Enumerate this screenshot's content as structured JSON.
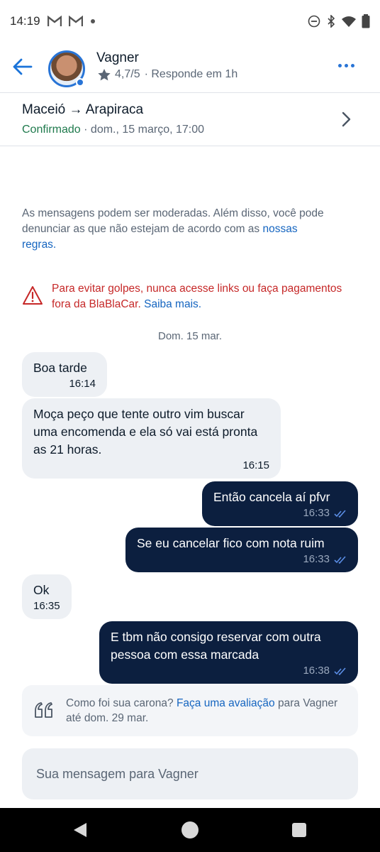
{
  "status_bar": {
    "time": "14:19",
    "notification_icons": [
      "gmail-icon",
      "gmail-icon",
      "dot-icon"
    ],
    "system_icons": [
      "do-not-disturb-icon",
      "bluetooth-icon",
      "wifi-icon",
      "battery-icon"
    ]
  },
  "header": {
    "driver_name": "Vagner",
    "rating": "4,7/5",
    "response_time": "· Responde em 1h"
  },
  "trip": {
    "route": "Maceió → Arapiraca",
    "status": "Confirmado",
    "datetime": "· dom., 15 março, 17:00"
  },
  "notices": {
    "moderation_text": "As mensagens podem ser moderadas. Além disso, você pode denunciar as que não estejam de acordo com as",
    "moderation_link": "nossas regras.",
    "warning_text": "Para evitar golpes, nunca acesse links ou faça pagamentos fora da BlaBlaCar.",
    "warning_link": "Saiba mais."
  },
  "conversation": {
    "date_label": "Dom. 15 mar.",
    "messages": [
      {
        "direction": "in",
        "text": "Boa tarde",
        "time": "16:14"
      },
      {
        "direction": "in",
        "text": "Moça peço que tente outro vim buscar uma encomenda e ela só vai está pronta as 21 horas.",
        "time": "16:15"
      },
      {
        "direction": "out",
        "text": "Então cancela aí pfvr",
        "time": "16:33",
        "read": true
      },
      {
        "direction": "out",
        "text": "Se eu cancelar fico com nota ruim",
        "time": "16:33",
        "read": true
      },
      {
        "direction": "in",
        "text": "Ok",
        "time": "16:35"
      },
      {
        "direction": "out",
        "text": "E tbm não consigo reservar com outra pessoa com essa marcada",
        "time": "16:38",
        "read": true
      }
    ]
  },
  "review_prompt": {
    "text_before": "Como foi sua carona?",
    "link": "Faça uma avaliação",
    "text_after": "para Vagner até dom. 29 mar."
  },
  "composer": {
    "placeholder": "Sua mensagem para Vagner"
  },
  "colors": {
    "accent": "#2874d6",
    "link": "#1565c0",
    "confirmed": "#1f7a4d",
    "warning": "#c62828",
    "outgoing_bubble": "#0c1f3f",
    "incoming_bubble": "#edf0f4"
  }
}
